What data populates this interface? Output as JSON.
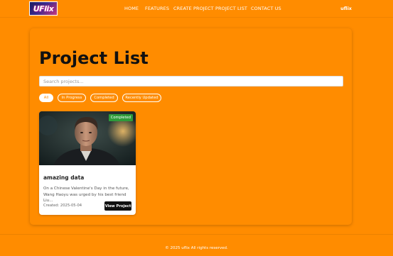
{
  "navbar": {
    "logo_text": "UFlix",
    "links": [
      "HOME",
      "FEATURES",
      "CREATE PROJECT",
      "PROJECT LIST",
      "CONTACT US"
    ],
    "brand": "uflix"
  },
  "main": {
    "title": "Project List",
    "search_placeholder": "Search projects...",
    "filters": [
      "All",
      "In Progress",
      "Completed",
      "Recently Updated"
    ],
    "active_filter": "All"
  },
  "project": {
    "status": "Completed",
    "title": "amazing data",
    "description": "On a Chinese Valentine's Day in the future, Wang Haoyu was urged by his best friend Liu...",
    "created": "Created: 2025-05-04",
    "view_label": "View Project"
  },
  "footer": {
    "text": "© 2025 uflix All rights reserved."
  },
  "colors": {
    "background": "#ff8c00",
    "badge": "#2e9b3a",
    "button": "#111111"
  }
}
